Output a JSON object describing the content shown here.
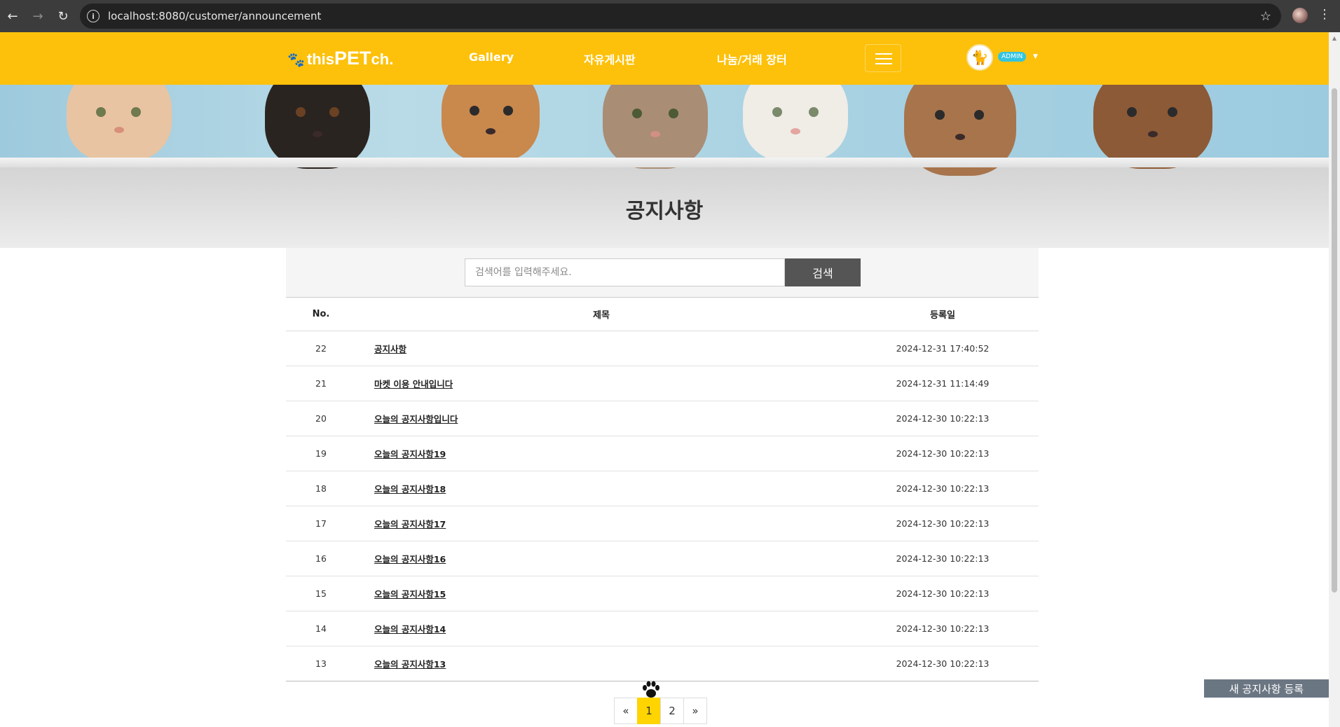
{
  "browser": {
    "url": "localhost:8080/customer/announcement"
  },
  "header": {
    "logo_prefix": "this",
    "logo_big": "PET",
    "logo_suffix": " ch.",
    "menu": [
      "Gallery",
      "자유게시판",
      "나눔/거래 장터"
    ],
    "admin_badge": "ADMIN",
    "accent_color": "#fdc10b"
  },
  "hero": {
    "title": "공지사항"
  },
  "search": {
    "placeholder": "검색어를 입력해주세요.",
    "button_label": "검색"
  },
  "table": {
    "headers": {
      "no": "No.",
      "title": "제목",
      "date": "등록일"
    },
    "rows": [
      {
        "no": "22",
        "title": "공지사항",
        "date": "2024-12-31 17:40:52"
      },
      {
        "no": "21",
        "title": "마켓 이용 안내입니다",
        "date": "2024-12-31 11:14:49"
      },
      {
        "no": "20",
        "title": "오늘의 공지사항입니다",
        "date": "2024-12-30 10:22:13"
      },
      {
        "no": "19",
        "title": "오늘의 공지사항19",
        "date": "2024-12-30 10:22:13"
      },
      {
        "no": "18",
        "title": "오늘의 공지사항18",
        "date": "2024-12-30 10:22:13"
      },
      {
        "no": "17",
        "title": "오늘의 공지사항17",
        "date": "2024-12-30 10:22:13"
      },
      {
        "no": "16",
        "title": "오늘의 공지사항16",
        "date": "2024-12-30 10:22:13"
      },
      {
        "no": "15",
        "title": "오늘의 공지사항15",
        "date": "2024-12-30 10:22:13"
      },
      {
        "no": "14",
        "title": "오늘의 공지사항14",
        "date": "2024-12-30 10:22:13"
      },
      {
        "no": "13",
        "title": "오늘의 공지사항13",
        "date": "2024-12-30 10:22:13"
      }
    ]
  },
  "pagination": {
    "prev": "«",
    "pages": [
      "1",
      "2"
    ],
    "current": "1",
    "next": "»"
  },
  "actions": {
    "new_announcement": "새 공지사항 등록"
  }
}
